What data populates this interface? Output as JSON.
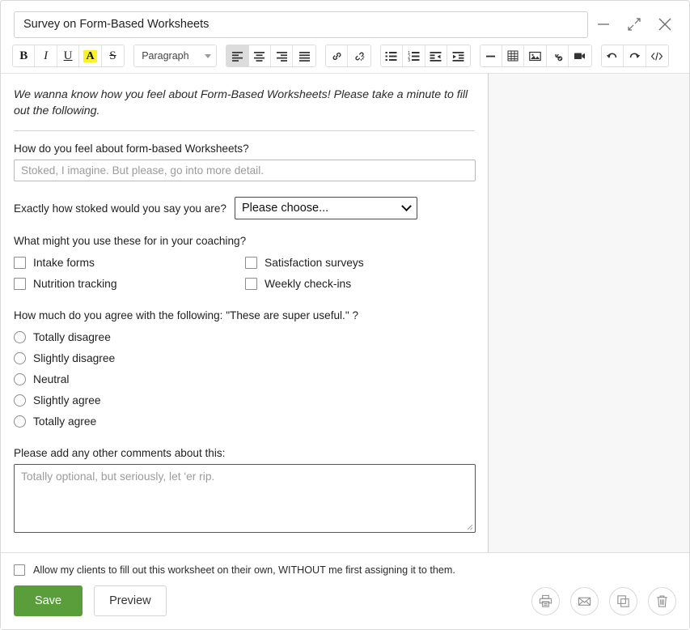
{
  "header": {
    "title_value": "Survey on Form-Based Worksheets",
    "title_placeholder": "Worksheet title",
    "controls": [
      {
        "name": "minimize-button",
        "label": "Minimize"
      },
      {
        "name": "collapse-button",
        "label": "Collapse"
      },
      {
        "name": "close-button",
        "label": "Close"
      }
    ]
  },
  "toolbar": {
    "bold": "B",
    "italic": "I",
    "underline": "U",
    "highlight": "A",
    "strikethrough": "S",
    "paragraph_select": "Paragraph",
    "align_left": "Align left",
    "align_center": "Align center",
    "align_right": "Align right",
    "align_justify": "Justify",
    "link": "Insert link",
    "unlink": "Remove link",
    "bullet_list": "Bulleted list",
    "numbered_list": "Numbered list",
    "outdent": "Decrease indent",
    "indent": "Increase indent",
    "horizontal_rule": "Horizontal rule",
    "table": "Insert table",
    "image": "Insert image",
    "media": "Insert media",
    "video": "Insert video",
    "undo": "Undo",
    "redo": "Redo",
    "source_code": "Source code"
  },
  "editor": {
    "intro": "We wanna know how you feel about Form-Based Worksheets! Please take a minute to fill out the following.",
    "q1": {
      "label": "How do you feel about form-based Worksheets?",
      "placeholder": "Stoked, I imagine. But please, go into more detail.",
      "value": ""
    },
    "q2": {
      "label": "Exactly how stoked would you say you are?",
      "selected": "Please choose..."
    },
    "q3": {
      "label": "What might you use these for in your coaching?",
      "options": [
        "Intake forms",
        "Satisfaction surveys",
        "Nutrition tracking",
        "Weekly check-ins"
      ]
    },
    "q4": {
      "label": "How much do you agree with the following: \"These are super useful.\" ?",
      "options": [
        "Totally disagree",
        "Slightly disagree",
        "Neutral",
        "Slightly agree",
        "Totally agree"
      ]
    },
    "q5": {
      "label": "Please add any other comments about this:",
      "placeholder": "Totally optional, but seriously, let 'er rip.",
      "value": ""
    }
  },
  "footer": {
    "allow_label": "Allow my clients to fill out this worksheet on their own, WITHOUT me first assigning it to them.",
    "save_label": "Save",
    "preview_label": "Preview",
    "icons": [
      {
        "name": "print-icon",
        "label": "Print"
      },
      {
        "name": "email-icon",
        "label": "Email"
      },
      {
        "name": "duplicate-icon",
        "label": "Duplicate"
      },
      {
        "name": "trash-icon",
        "label": "Delete"
      }
    ]
  },
  "colors": {
    "save_green": "#5a9e3c",
    "highlight_yellow": "#fbf31e",
    "side_panel": "#f7f7f7"
  }
}
